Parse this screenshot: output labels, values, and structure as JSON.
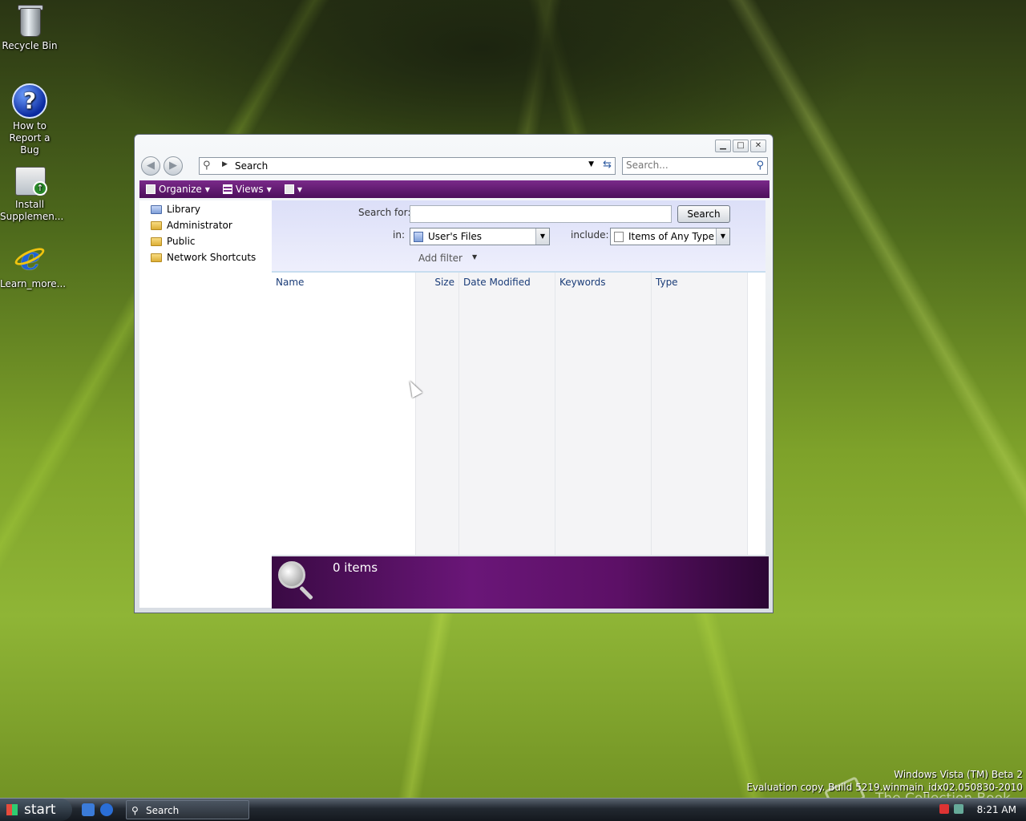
{
  "desktop": {
    "icons": [
      {
        "label": "Recycle Bin",
        "icon": "recycle-bin-icon"
      },
      {
        "label": "How to Report a Bug",
        "icon": "help-icon"
      },
      {
        "label": "Install Supplemen...",
        "icon": "install-icon"
      },
      {
        "label": "Learn_more...",
        "icon": "internet-explorer-icon"
      }
    ]
  },
  "window": {
    "caption_buttons": [
      "minimize",
      "maximize",
      "close"
    ],
    "address": {
      "location": "Search"
    },
    "search_box": {
      "placeholder": "Search..."
    },
    "toolbar": {
      "organize": "Organize",
      "views": "Views"
    },
    "nav_pane": {
      "items": [
        {
          "label": "Library",
          "icon": "library-icon"
        },
        {
          "label": "Administrator",
          "icon": "folder-icon"
        },
        {
          "label": "Public",
          "icon": "folder-icon"
        },
        {
          "label": "Network Shortcuts",
          "icon": "folder-icon"
        }
      ]
    },
    "search_pane": {
      "search_for_label": "Search for:",
      "search_for_value": "",
      "search_button": "Search",
      "in_label": "in:",
      "in_value": "User's Files",
      "include_label": "include:",
      "include_value": "Items of Any Type",
      "add_filter": "Add filter"
    },
    "list": {
      "columns": [
        "Name",
        "Size",
        "Date Modified",
        "Keywords",
        "Type"
      ],
      "rows": []
    },
    "details": {
      "count": "0 items"
    },
    "accent_color": "#5c1066"
  },
  "watermark": {
    "line1": "Windows Vista (TM) Beta 2",
    "line2": "Evaluation copy. Build 5219.winmain_idx02.050830-2010",
    "overlay": "The Collection Book"
  },
  "taskbar": {
    "start": "start",
    "task": "Search",
    "clock": "8:21 AM"
  }
}
